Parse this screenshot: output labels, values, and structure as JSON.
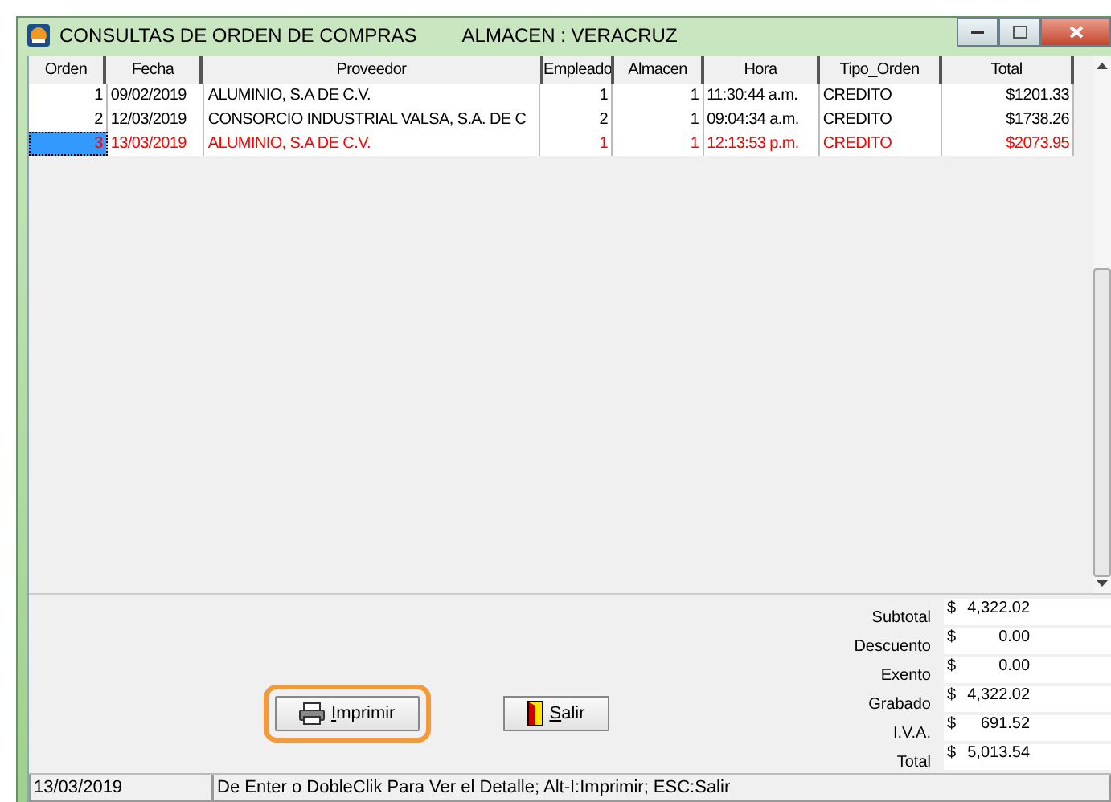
{
  "window": {
    "title": "CONSULTAS DE ORDEN DE COMPRAS",
    "subtitle": "ALMACEN : VERACRUZ"
  },
  "table": {
    "columns": [
      "Orden",
      "Fecha",
      "Proveedor",
      "Empleado",
      "Almacen",
      "Hora",
      "Tipo_Orden",
      "Total"
    ],
    "rows": [
      {
        "cells": [
          "1",
          "09/02/2019",
          "ALUMINIO, S.A DE C.V.",
          "1",
          "1",
          "11:30:44 a.m.",
          "CREDITO",
          "$1201.33"
        ],
        "selected": false
      },
      {
        "cells": [
          "2",
          "12/03/2019",
          "CONSORCIO INDUSTRIAL VALSA, S.A. DE C",
          "2",
          "1",
          "09:04:34 a.m.",
          "CREDITO",
          "$1738.26"
        ],
        "selected": false
      },
      {
        "cells": [
          "3",
          "13/03/2019",
          "ALUMINIO, S.A DE C.V.",
          "1",
          "1",
          "12:13:53 p.m.",
          "CREDITO",
          "$2073.95"
        ],
        "selected": true
      }
    ]
  },
  "buttons": [
    {
      "kind": "print",
      "label": "Imprimir",
      "focused": true
    },
    {
      "kind": "exit",
      "label": "Salir",
      "focused": false
    }
  ],
  "totals": [
    {
      "label": "Subtotal",
      "currency": "$",
      "value": "4,322.02"
    },
    {
      "label": "Descuento",
      "currency": "$",
      "value": "0.00"
    },
    {
      "label": "Exento",
      "currency": "$",
      "value": "0.00"
    },
    {
      "label": "Grabado",
      "currency": "$",
      "value": "4,322.02"
    },
    {
      "label": "I.V.A.",
      "currency": "$",
      "value": "691.52"
    },
    {
      "label": "Total",
      "currency": "$",
      "value": "5,013.54"
    }
  ],
  "status_bar": {
    "date": "13/03/2019",
    "hint": "De Enter o DobleClik Para Ver el Detalle; Alt-I:Imprimir; ESC:Salir"
  }
}
